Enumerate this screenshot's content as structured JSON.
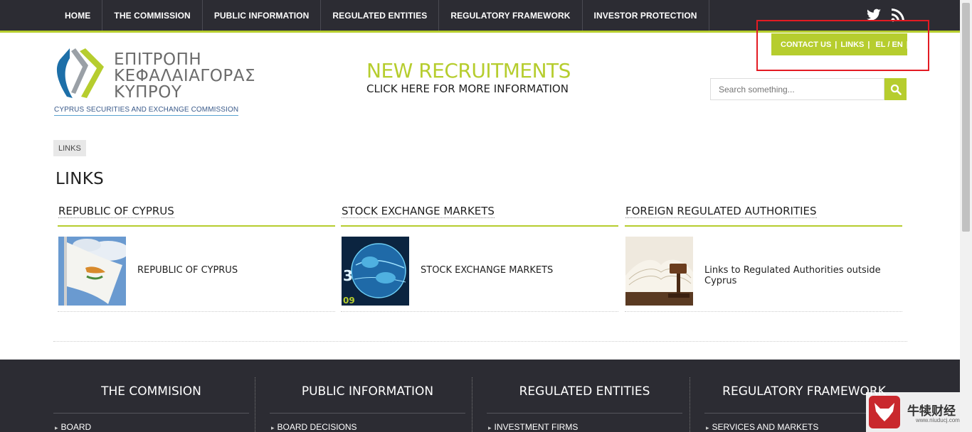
{
  "nav": {
    "items": [
      {
        "label": "HOME"
      },
      {
        "label": "THE COMMISSION"
      },
      {
        "label": "PUBLIC INFORMATION"
      },
      {
        "label": "REGULATED ENTITIES"
      },
      {
        "label": "REGULATORY FRAMEWORK"
      },
      {
        "label": "INVESTOR PROTECTION"
      }
    ],
    "social": [
      "twitter-icon",
      "rss-icon"
    ]
  },
  "logo": {
    "line1": "ΕΠΙΤΡΟΠΗ",
    "line2": "ΚΕΦΑΛΑΙΑΓΟΡΑΣ",
    "line3": "ΚΥΠΡΟΥ",
    "subtitle": "CYPRUS SECURITIES AND EXCHANGE COMMISSION"
  },
  "recruit": {
    "headline": "NEW RECRUITMENTS",
    "subline": "CLICK HERE FOR MORE INFORMATION"
  },
  "quicklinks": {
    "contact": "CONTACT US",
    "sep": "|",
    "links": "LINKS",
    "lang": "EL / EN",
    "trail": "|"
  },
  "search": {
    "placeholder": "Search something...",
    "icon": "search-icon"
  },
  "breadcrumb": "LINKS",
  "title": "LINKS",
  "columns": [
    {
      "heading": "REPUBLIC OF CYPRUS",
      "entry": "REPUBLIC OF CYPRUS"
    },
    {
      "heading": "STOCK EXCHANGE MARKETS",
      "entry": "STOCK EXCHANGE MARKETS"
    },
    {
      "heading": "FOREIGN REGULATED AUTHORITIES",
      "entry": "Links to Regulated Authorities outside Cyprus"
    }
  ],
  "footer": {
    "columns": [
      {
        "title": "THE COMMISION",
        "link": "BOARD"
      },
      {
        "title": "PUBLIC INFORMATION",
        "link": "BOARD DECISIONS"
      },
      {
        "title": "REGULATED ENTITIES",
        "link": "INVESTMENT FIRMS"
      },
      {
        "title": "REGULATORY FRAMEWORK",
        "link": "SERVICES AND MARKETS"
      }
    ]
  },
  "watermark": {
    "text": "牛犊财经",
    "url": "www.niuducj.com"
  },
  "colors": {
    "accent": "#b6cd2e",
    "dark": "#2c2c33",
    "highlight": "#e31b23"
  }
}
